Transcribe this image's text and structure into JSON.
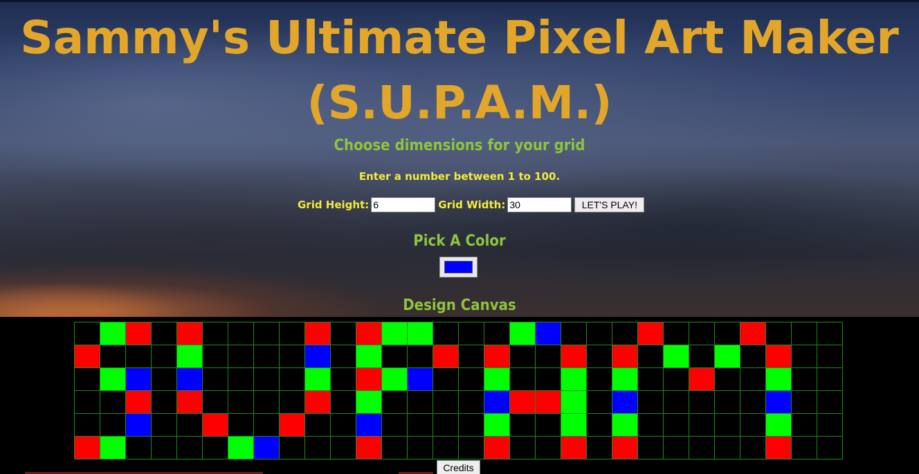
{
  "page": {
    "title_line1": "Sammy's Ultimate Pixel Art Maker",
    "title_line2": "(S.U.P.A.M.)",
    "dimensions_heading": "Choose dimensions for your grid",
    "hint": "Enter a number between 1 to 100.",
    "color_heading": "Pick A Color",
    "canvas_heading": "Design Canvas"
  },
  "form": {
    "height_label": "Grid Height:",
    "height_value": "6",
    "width_label": "Grid Width:",
    "width_value": "30",
    "submit_label": "LET'S PLAY!"
  },
  "color_picker": {
    "value": "#0000ff"
  },
  "footer": {
    "credits_label": "Credits"
  },
  "colors": {
    "title": "#e1a62a",
    "heading": "#8dc53e",
    "label": "#f3ec3a",
    "grid_line": "#1f8a1f",
    "K": "#000000",
    "G": "#00ff00",
    "R": "#ff0000",
    "B": "#0000ff"
  },
  "grid": {
    "rows": 6,
    "cols": 30,
    "cells": [
      "KGRKRKKKKRKRGGKKKGBKKKRKKKRKKK",
      "RKKKGKKKKBKGKKRKRKKRKRKGKGKRKK",
      "KGBKBKKKKGKRGBKKGKKGKGKKRKKGKK",
      "KKRKRKKKKRKGKKKKBRRGKBKKKKKBKK",
      "KKBKKRKKRKKBKKKKGKKGKGKKKKKGKK",
      "RGKKKKGBKKKRKKKKRKKRKRKKKKKRKK"
    ]
  }
}
